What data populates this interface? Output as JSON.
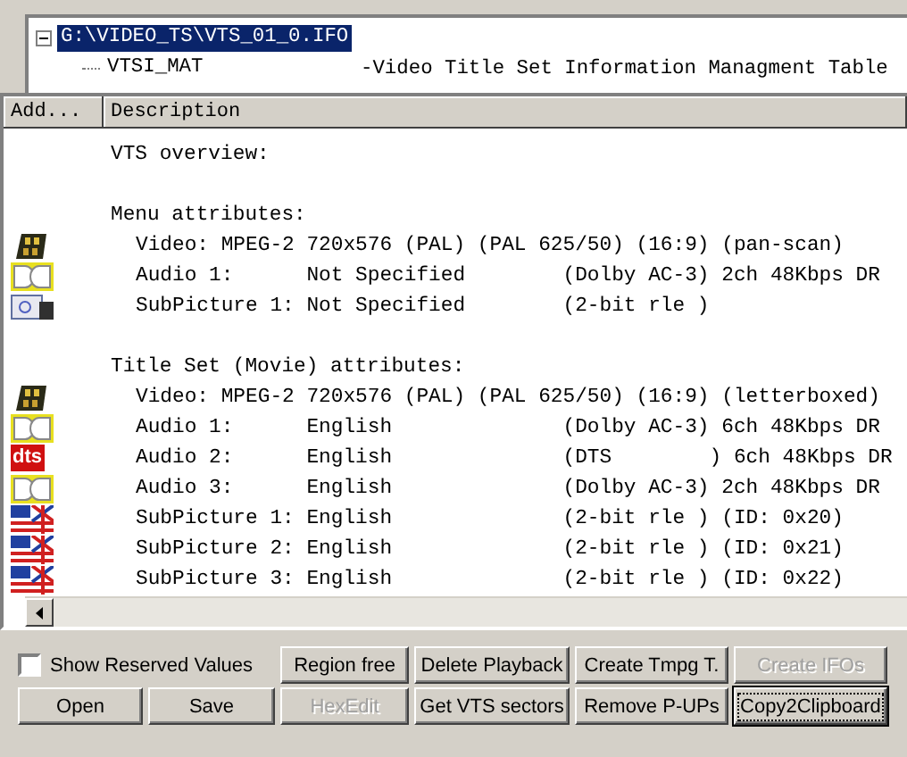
{
  "tree": {
    "root": {
      "label": "G:\\VIDEO_TS\\VTS_01_0.IFO",
      "selected": true,
      "expanded": true,
      "children": [
        {
          "label": "VTSI_MAT",
          "description": "-Video Title Set Information Managment Table",
          "selected": false
        }
      ]
    }
  },
  "list": {
    "columns": [
      "Add...",
      "Description"
    ],
    "sections": [
      {
        "title": "VTS overview:"
      },
      {
        "title": "Menu attributes:",
        "rows": [
          {
            "kind": "film",
            "text": "Video: MPEG-2 720x576 (PAL) (PAL 625/50) (16:9) (pan-scan)"
          },
          {
            "kind": "dolby",
            "text": "Audio 1:      Not Specified        (Dolby AC-3) 2ch 48Kbps DR"
          },
          {
            "kind": "subpicture",
            "text": "SubPicture 1: Not Specified        (2-bit rle )"
          }
        ]
      },
      {
        "title": "Title Set (Movie) attributes:",
        "rows": [
          {
            "kind": "film",
            "text": "Video: MPEG-2 720x576 (PAL) (PAL 625/50) (16:9) (letterboxed)"
          },
          {
            "kind": "dolby",
            "text": "Audio 1:      English              (Dolby AC-3) 6ch 48Kbps DR"
          },
          {
            "kind": "dts",
            "badge": "dts",
            "text": "Audio 2:      English              (DTS        ) 6ch 48Kbps DR"
          },
          {
            "kind": "dolby",
            "text": "Audio 3:      English              (Dolby AC-3) 2ch 48Kbps DR"
          },
          {
            "kind": "flag",
            "text": "SubPicture 1: English              (2-bit rle ) (ID: 0x20)"
          },
          {
            "kind": "flag",
            "text": "SubPicture 2: English              (2-bit rle ) (ID: 0x21)"
          },
          {
            "kind": "flag",
            "text": "SubPicture 3: English              (2-bit rle ) (ID: 0x22)"
          }
        ]
      }
    ]
  },
  "show_reserved": {
    "label": "Show Reserved Values",
    "checked": false
  },
  "buttons": [
    {
      "label": "Region free",
      "disabled": false,
      "focused": false
    },
    {
      "label": "Delete Playback",
      "disabled": false,
      "focused": false
    },
    {
      "label": "Create Tmpg T.",
      "disabled": false,
      "focused": false
    },
    {
      "label": "Create IFOs",
      "disabled": true,
      "focused": false
    },
    {
      "label": "Open",
      "disabled": false,
      "focused": false
    },
    {
      "label": "Save",
      "disabled": false,
      "focused": false
    },
    {
      "label": "HexEdit",
      "disabled": true,
      "focused": false
    },
    {
      "label": "Get VTS sectors",
      "disabled": false,
      "focused": false
    },
    {
      "label": "Remove P-UPs",
      "disabled": false,
      "focused": false
    },
    {
      "label": "Copy2Clipboard",
      "disabled": false,
      "focused": true
    }
  ]
}
